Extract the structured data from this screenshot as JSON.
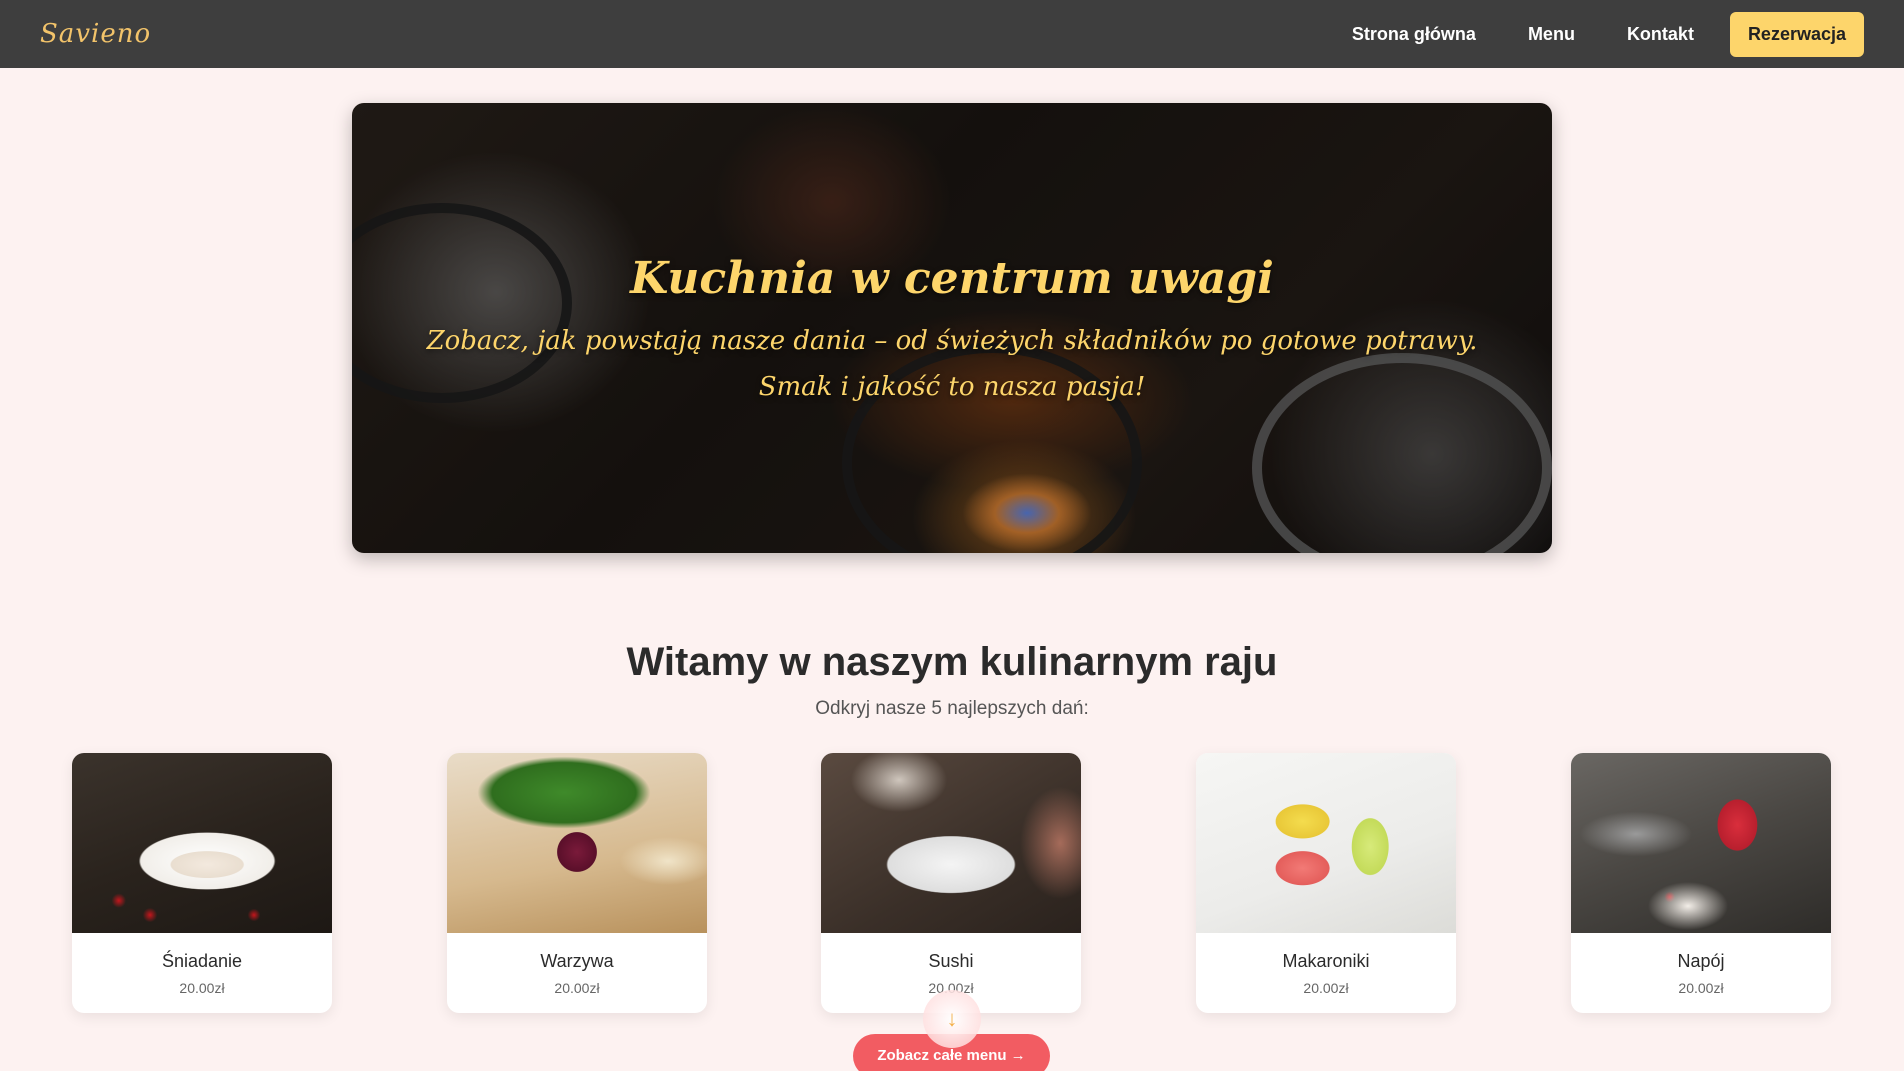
{
  "nav": {
    "logo": "Savieno",
    "links": [
      "Strona główna",
      "Menu",
      "Kontakt"
    ],
    "reserve": "Rezerwacja"
  },
  "hero": {
    "title": "Kuchnia w centrum uwagi",
    "subtitle": "Zobacz, jak powstają nasze dania – od świeżych składników po gotowe potrawy. Smak i jakość to nasza pasja!"
  },
  "welcome": {
    "title": "Witamy w naszym kulinarnym raju",
    "subtitle": "Odkryj nasze 5 najlepszych dań:"
  },
  "dishes": [
    {
      "name": "Śniadanie",
      "price": "20.00zł"
    },
    {
      "name": "Warzywa",
      "price": "20.00zł"
    },
    {
      "name": "Sushi",
      "price": "20.00zł"
    },
    {
      "name": "Makaroniki",
      "price": "20.00zł"
    },
    {
      "name": "Napój",
      "price": "20.00zł"
    }
  ],
  "cta": {
    "label": "Zobacz całe menu →",
    "scroll_icon": "arrow-down-icon"
  },
  "colors": {
    "nav_bg": "#3e3e3e",
    "accent_yellow": "#fdd56b",
    "cta_red": "#f25c62",
    "page_bg": "#fdf2f1"
  }
}
